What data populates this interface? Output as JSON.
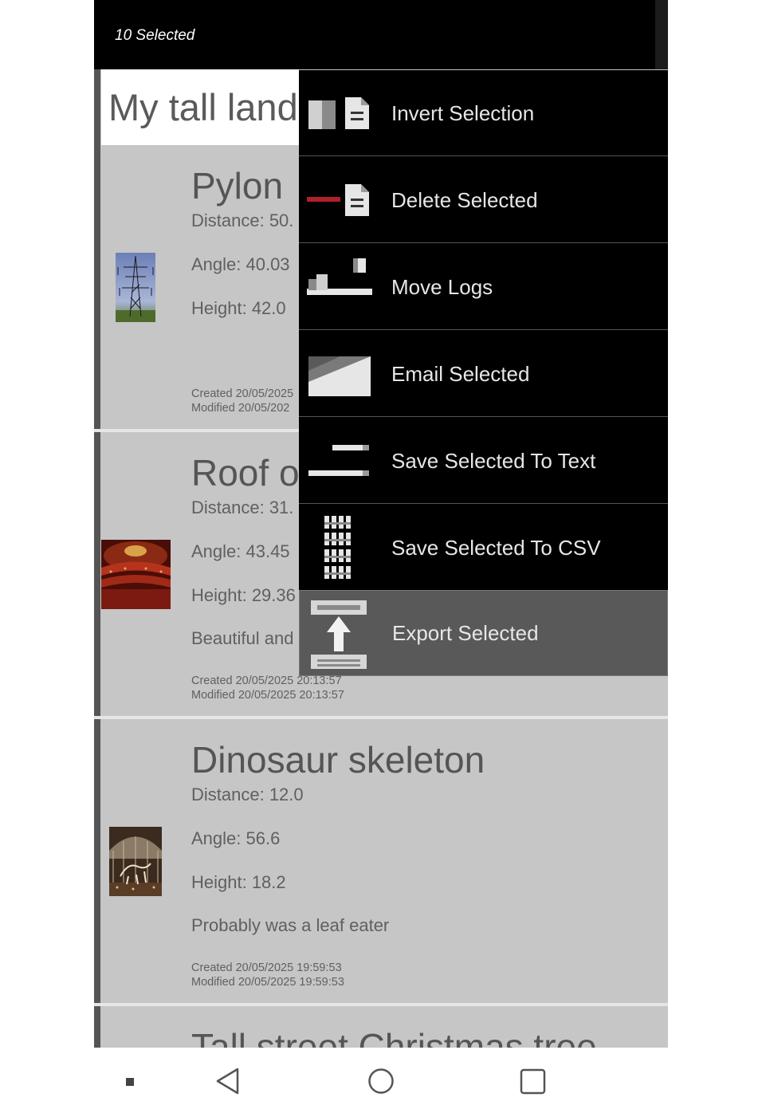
{
  "toolbar": {
    "selection_text": "10 Selected"
  },
  "list": {
    "title_value": "My tall land"
  },
  "cards": [
    {
      "name": "Pylon",
      "distance": "Distance: 50.",
      "angle": "Angle: 40.03",
      "height": "Height: 42.0",
      "note": "",
      "created": "Created 20/05/2025",
      "modified": "Modified 20/05/202"
    },
    {
      "name": "Roof o",
      "distance": "Distance: 31.",
      "angle": "Angle: 43.45",
      "height": "Height: 29.36",
      "note": "Beautiful and",
      "created": "Created 20/05/2025 20:13:57",
      "modified": "Modified 20/05/2025 20:13:57"
    },
    {
      "name": "Dinosaur skeleton",
      "distance": "Distance: 12.0",
      "angle": "Angle: 56.6",
      "height": "Height: 18.2",
      "note": "Probably was a leaf eater",
      "created": "Created 20/05/2025 19:59:53",
      "modified": "Modified 20/05/2025 19:59:53"
    },
    {
      "name": "Tall street Christmas tree"
    }
  ],
  "menu": {
    "items": [
      {
        "label": "Invert Selection",
        "icon": "invert-selection-icon"
      },
      {
        "label": "Delete Selected",
        "icon": "delete-selected-icon"
      },
      {
        "label": "Move Logs",
        "icon": "move-logs-icon"
      },
      {
        "label": "Email Selected",
        "icon": "email-icon"
      },
      {
        "label": "Save Selected To Text",
        "icon": "text-file-icon"
      },
      {
        "label": "Save Selected To CSV",
        "icon": "csv-grid-icon"
      },
      {
        "label": "Export Selected",
        "icon": "export-icon",
        "highlighted": true
      }
    ]
  },
  "colors": {
    "toolbar_bg": "#000000",
    "card_bg": "#c6c6c6",
    "menu_bg": "#000000",
    "menu_highlight": "#595959",
    "delete_accent": "#b0202a"
  }
}
